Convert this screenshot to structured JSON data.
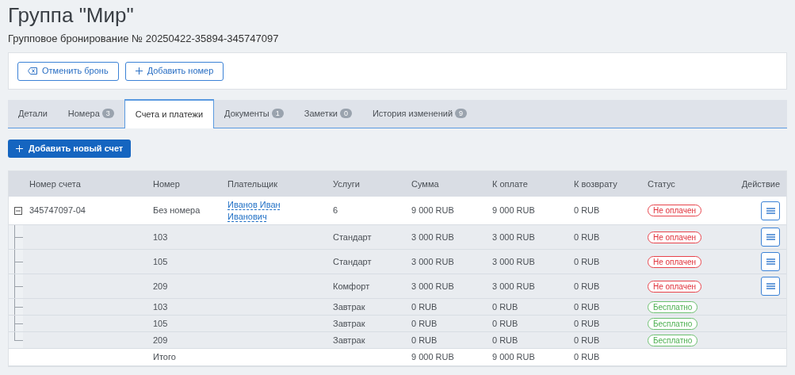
{
  "title": "Группа \"Мир\"",
  "subtitle": "Групповое бронирование № 20250422-35894-345747097",
  "toolbar": [
    {
      "label": "Отменить бронь",
      "kind": "cancel"
    },
    {
      "label": "Добавить номер",
      "kind": "add"
    }
  ],
  "tabs": [
    {
      "label": "Детали",
      "selected": false
    },
    {
      "label": "Номера",
      "count": "3",
      "selected": false
    },
    {
      "label": "Счета и платежи",
      "selected": true
    },
    {
      "label": "Документы",
      "count": "1",
      "selected": false
    },
    {
      "label": "Заметки",
      "count": "0",
      "selected": false
    },
    {
      "label": "История изменений",
      "count": "9",
      "selected": false
    }
  ],
  "add_button": "Добавить новый счет",
  "table": {
    "columns": [
      "Номер счета",
      "Номер",
      "Плательщик",
      "Услуги",
      "Сумма",
      "К оплате",
      "К возврату",
      "Статус",
      "Действие"
    ],
    "rows": [
      {
        "kind": "invoice",
        "expanded": true,
        "account": "345747097-04",
        "room": "Без номера",
        "payer": "Иванов Иван Иванович",
        "services": "6",
        "sum": "9 000 RUB",
        "to_pay": "9 000 RUB",
        "refund": "0 RUB",
        "status": {
          "label": "Не оплачен",
          "kind": "unpaid"
        },
        "menu": true
      },
      {
        "kind": "item",
        "room": "103",
        "services": "Стандарт",
        "sum": "3 000 RUB",
        "to_pay": "3 000 RUB",
        "refund": "0 RUB",
        "status": {
          "label": "Не оплачен",
          "kind": "unpaid"
        },
        "menu": true
      },
      {
        "kind": "item",
        "room": "105",
        "services": "Стандарт",
        "sum": "3 000 RUB",
        "to_pay": "3 000 RUB",
        "refund": "0 RUB",
        "status": {
          "label": "Не оплачен",
          "kind": "unpaid"
        },
        "menu": true
      },
      {
        "kind": "item",
        "room": "209",
        "services": "Комфорт",
        "sum": "3 000 RUB",
        "to_pay": "3 000 RUB",
        "refund": "0 RUB",
        "status": {
          "label": "Не оплачен",
          "kind": "unpaid"
        },
        "menu": true
      },
      {
        "kind": "item",
        "room": "103",
        "services": "Завтрак",
        "sum": "0 RUB",
        "to_pay": "0 RUB",
        "refund": "0 RUB",
        "status": {
          "label": "Бесплатно",
          "kind": "free"
        },
        "menu": false
      },
      {
        "kind": "item",
        "room": "105",
        "services": "Завтрак",
        "sum": "0 RUB",
        "to_pay": "0 RUB",
        "refund": "0 RUB",
        "status": {
          "label": "Бесплатно",
          "kind": "free"
        },
        "menu": false
      },
      {
        "kind": "item",
        "room": "209",
        "services": "Завтрак",
        "sum": "0 RUB",
        "to_pay": "0 RUB",
        "refund": "0 RUB",
        "status": {
          "label": "Бесплатно",
          "kind": "free"
        },
        "menu": false
      },
      {
        "kind": "total",
        "room": "Итого",
        "sum": "9 000 RUB",
        "to_pay": "9 000 RUB",
        "refund": "0 RUB"
      }
    ]
  }
}
